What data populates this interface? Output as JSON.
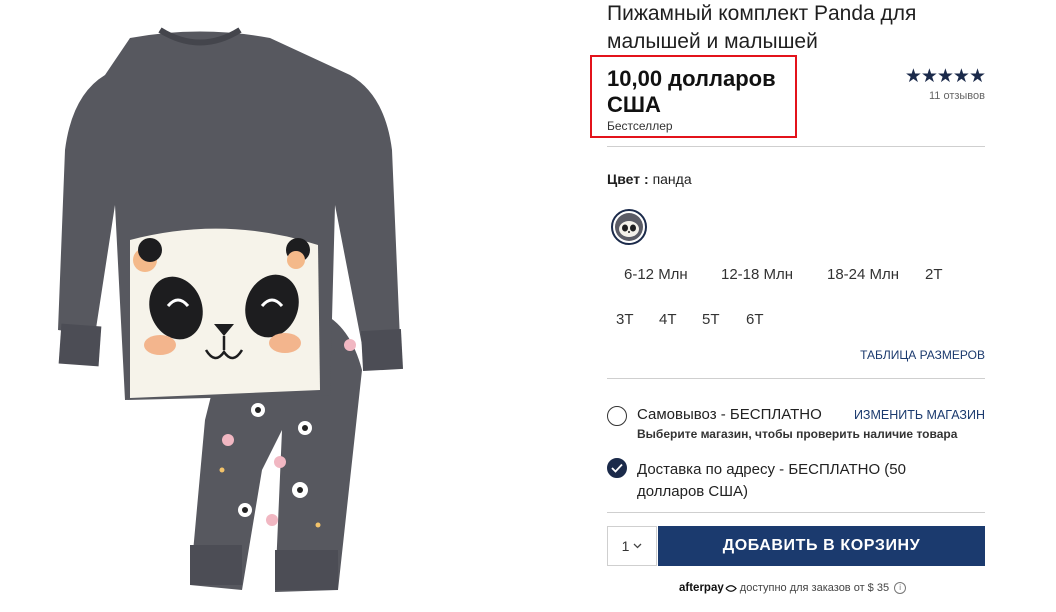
{
  "product": {
    "title": "Пижамный комплект Panda для малышей и малышей",
    "price": "10,00 долларов США",
    "badge": "Бестселлер",
    "rating": {
      "stars": "★★★★★",
      "value": 5,
      "reviews": "11 отзывов"
    }
  },
  "color": {
    "label": "Цвет",
    "separator": " : ",
    "value": "панда",
    "swatch_icon": "panda-swatch-icon"
  },
  "sizes": [
    "6-12 Млн",
    "12-18 Млн",
    "18-24 Млн",
    "2Т",
    "3Т",
    "4Т",
    "5Т",
    "6Т"
  ],
  "size_chart_link": "ТАБЛИЦА РАЗМЕРОВ",
  "fulfillment": {
    "pickup": {
      "label": "Самовывоз - БЕСПЛАТНО",
      "sub": "Выберите магазин, чтобы проверить наличие товара",
      "selected": false
    },
    "change_store": "ИЗМЕНИТЬ МАГАЗИН",
    "delivery": {
      "label": "Доставка по адресу - БЕСПЛАТНО",
      "suffix": " (50 долларов США)",
      "selected": true
    }
  },
  "quantity": {
    "value": "1",
    "icon": "chevron-down-icon"
  },
  "add_to_cart": "ДОБАВИТЬ В КОРЗИНУ",
  "afterpay": {
    "brand": "afterpay",
    "text": " доступно для заказов от $ 35",
    "icon": "info-icon"
  },
  "colors": {
    "navy": "#1b3a6e",
    "star": "#1b2a4a",
    "highlight": "#e3131b",
    "garment": "#55565f"
  }
}
